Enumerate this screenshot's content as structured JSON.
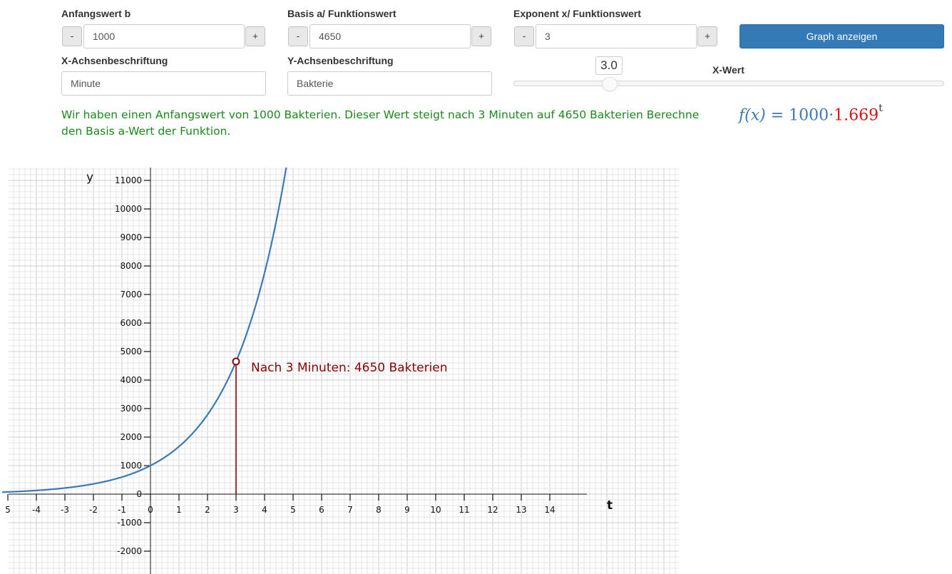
{
  "fields": {
    "anfangswert": {
      "label": "Anfangswert b",
      "value": "1000",
      "minus": "-",
      "plus": "+"
    },
    "basis": {
      "label": "Basis a/ Funktionswert",
      "value": "4650",
      "minus": "-",
      "plus": "+"
    },
    "exponent": {
      "label": "Exponent x/ Funktionswert",
      "value": "3",
      "minus": "-",
      "plus": "+"
    },
    "x_achse": {
      "label": "X-Achsenbeschriftung",
      "value": "Minute"
    },
    "y_achse": {
      "label": "Y-Achsenbeschriftung",
      "value": "Bakterie"
    }
  },
  "graph_button": {
    "label": "Graph anzeigen"
  },
  "slider": {
    "label": "X-Wert",
    "value": 3.0,
    "value_text": "3.0",
    "min": 0,
    "max": 100
  },
  "task_text": "Wir haben einen Anfangswert von 1000 Bakterien. Dieser Wert steigt nach 3 Minuten auf 4650 Bakterien Berechne den Basis a-Wert der Funktion.",
  "formula": {
    "lhs": "f(x)",
    "eq": "=",
    "coefficient": "1000",
    "dot": "·",
    "base": "1.669",
    "exponent": "t"
  },
  "colors": {
    "primary_button": "#337ab7",
    "task_text": "#1a8a1a",
    "curve": "#3a7ab8",
    "marker": "#8b0000",
    "grid": "#d9d9d9",
    "base_red": "#dd1111"
  },
  "chart_data": {
    "type": "line",
    "function": "1000 * 1.669^t",
    "x_label": "t",
    "y_label": "y",
    "xlim": [
      -5.2,
      18.5
    ],
    "ylim": [
      -2750,
      11450
    ],
    "x_ticks": [
      -5,
      -4,
      -3,
      -2,
      -1,
      0,
      1,
      2,
      3,
      4,
      5,
      6,
      7,
      8,
      9,
      10,
      11,
      12,
      13,
      14
    ],
    "x_tick_labels": [
      "5",
      "-4",
      "-3",
      "-2",
      "-1",
      "0",
      "1",
      "2",
      "3",
      "4",
      "5",
      "6",
      "7",
      "8",
      "9",
      "10",
      "11",
      "12",
      "13",
      "14"
    ],
    "y_ticks": [
      -2000,
      -1000,
      0,
      1000,
      2000,
      3000,
      4000,
      5000,
      6000,
      7000,
      8000,
      9000,
      10000,
      11000
    ],
    "y_tick_labels": [
      "-2000",
      "-1000",
      "0",
      "1000",
      "2000",
      "3000",
      "4000",
      "5000",
      "6000",
      "7000",
      "8000",
      "9000",
      "10000",
      "11000"
    ],
    "x_axis_end": 15,
    "grid": true,
    "highlight_point": {
      "x": 3,
      "y": 4650,
      "label": "Nach 3 Minuten: 4650 Bakterien"
    }
  }
}
